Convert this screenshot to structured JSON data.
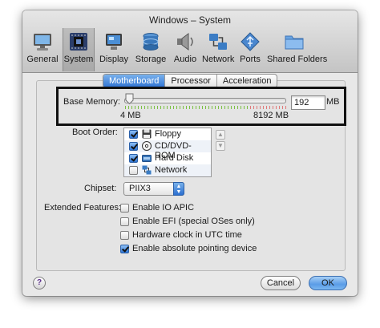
{
  "window": {
    "title": "Windows – System"
  },
  "toolbar": {
    "items": [
      {
        "label": "General",
        "icon": "monitor-icon"
      },
      {
        "label": "System",
        "icon": "chip-icon"
      },
      {
        "label": "Display",
        "icon": "display-icon"
      },
      {
        "label": "Storage",
        "icon": "disk-stack-icon"
      },
      {
        "label": "Audio",
        "icon": "speaker-icon"
      },
      {
        "label": "Network",
        "icon": "network-icon"
      },
      {
        "label": "Ports",
        "icon": "usb-ports-icon"
      },
      {
        "label": "Shared Folders",
        "icon": "folder-icon"
      }
    ],
    "selected": "System"
  },
  "tabs": {
    "items": [
      "Motherboard",
      "Processor",
      "Acceleration"
    ],
    "active": "Motherboard"
  },
  "base_memory": {
    "label": "Base Memory:",
    "value": "192",
    "unit": "MB",
    "min_label": "4 MB",
    "max_label": "8192 MB",
    "fraction": 0.023
  },
  "boot_order": {
    "label": "Boot Order:",
    "items": [
      {
        "label": "Floppy",
        "checked": true,
        "icon": "floppy-icon"
      },
      {
        "label": "CD/DVD-ROM",
        "checked": true,
        "icon": "cd-icon"
      },
      {
        "label": "Hard Disk",
        "checked": true,
        "icon": "hard-disk-icon"
      },
      {
        "label": "Network",
        "checked": false,
        "icon": "network-boot-icon"
      }
    ]
  },
  "chipset": {
    "label": "Chipset:",
    "value": "PIIX3"
  },
  "extended_features": {
    "label": "Extended Features:",
    "items": [
      {
        "label": "Enable IO APIC",
        "checked": false
      },
      {
        "label": "Enable EFI (special OSes only)",
        "checked": false
      },
      {
        "label": "Hardware clock in UTC time",
        "checked": false
      },
      {
        "label": "Enable absolute pointing device",
        "checked": true
      }
    ]
  },
  "buttons": {
    "help": "?",
    "cancel": "Cancel",
    "ok": "OK"
  },
  "colors": {
    "accent": "#2f73d4",
    "highlight_box": "#111111",
    "tick_green": "#7bc043",
    "tick_red": "#e07a7a"
  }
}
